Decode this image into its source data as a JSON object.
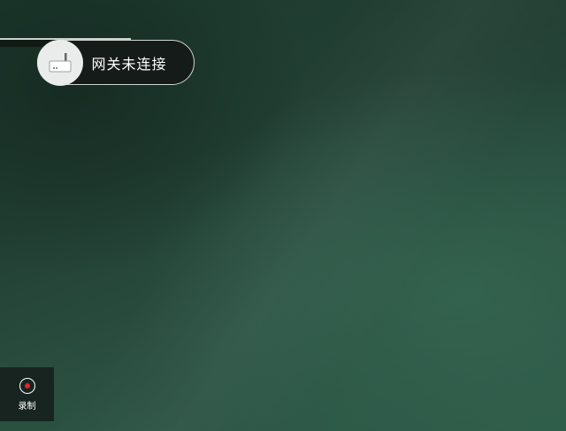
{
  "gateway": {
    "status_text": "网关未连接",
    "icon": "router-icon"
  },
  "record": {
    "label": "录制",
    "icon": "record-icon",
    "dot_color": "#e0252b"
  }
}
